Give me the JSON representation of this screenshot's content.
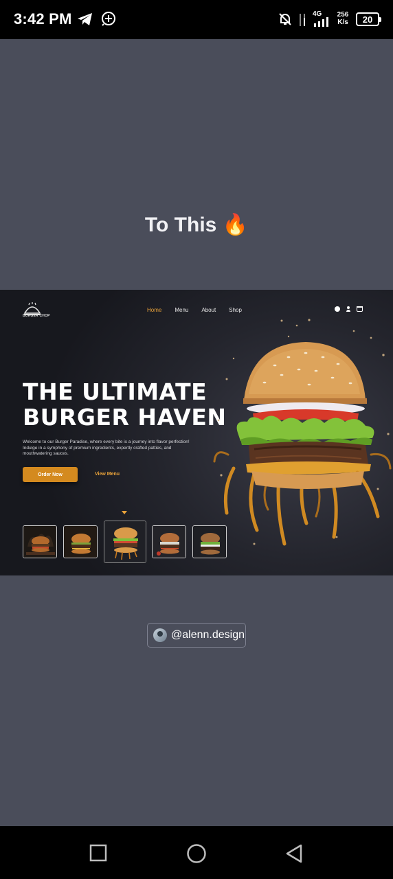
{
  "status_bar": {
    "time": "3:42 PM",
    "net_speed_value": "256",
    "net_speed_unit": "K/s",
    "network_type": "4G",
    "battery": "20",
    "icons": [
      "telegram-icon",
      "notification-plus-icon",
      "bell-off-icon",
      "data-arrows-icon",
      "signal-icon",
      "battery-icon"
    ]
  },
  "caption": {
    "text": "To This",
    "emoji": "🔥"
  },
  "site": {
    "logo_text": "BURGER CHOP",
    "nav": [
      "Home",
      "Menu",
      "About",
      "Shop"
    ],
    "active_nav": "Home",
    "nav_icons": [
      "search-icon",
      "user-icon",
      "cart-icon"
    ],
    "headline_line1": "THE ULTIMATE",
    "headline_line2": "BURGER HAVEN",
    "description_line1": "Welcome to our Burger Paradise, where every bite is a journey into flavor perfection!",
    "description_line2": "Indulge in a symphony of premium ingredients, expertly crafted patties, and",
    "description_line3": "mouthwatering sauces.",
    "order_button": "Order Now",
    "view_menu": "View Menu",
    "accent_color": "#d48a1f",
    "thumbnails_count_selected": 3
  },
  "credit": {
    "handle": "@alenn.design"
  },
  "system_nav": [
    "recents-square-icon",
    "home-circle-icon",
    "back-triangle-icon"
  ]
}
